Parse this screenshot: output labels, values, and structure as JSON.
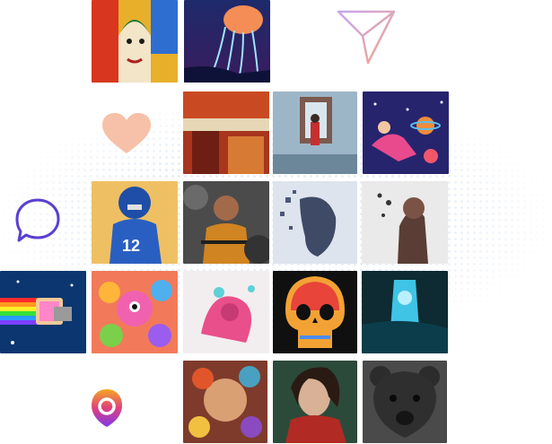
{
  "icons": {
    "send": "send-icon",
    "heart": "heart-icon",
    "chat": "chat-bubble-icon",
    "brand": "brand-logo-icon"
  },
  "colors": {
    "send_gradient": [
      "#c6a6ee",
      "#f3a98a"
    ],
    "heart": "#f6c1a8",
    "chat": "#5b3fd1",
    "brand_gradient": [
      "#f5a623",
      "#e0407b",
      "#7c3aed"
    ]
  },
  "gallery": [
    "cubist-portrait",
    "jellyfish-night",
    "abstract-red",
    "floating-window",
    "astronaut-space",
    "football-player",
    "smoke-portrait",
    "shattered-head",
    "dispersed-figure",
    "nyan-cat",
    "colorful-creatures",
    "pink-splash",
    "rainbow-skull",
    "blue-waterfall",
    "floral-face",
    "painted-woman",
    "bear-head"
  ]
}
